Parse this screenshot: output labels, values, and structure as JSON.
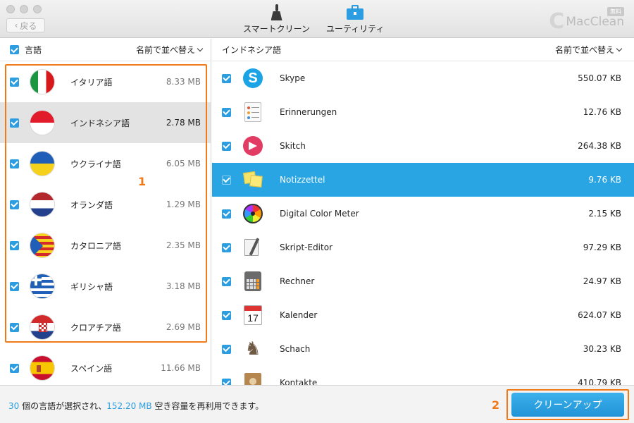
{
  "window": {
    "back_label": "戻る",
    "toolbar": [
      {
        "label": "スマートクリーン",
        "icon": "broom-icon"
      },
      {
        "label": "ユーティリティ",
        "icon": "toolbox-icon",
        "active": true
      }
    ],
    "brand": "MacClean",
    "badge": "無料"
  },
  "left_panel": {
    "header_label": "言語",
    "sort_label": "名前で並べ替え",
    "languages": [
      {
        "name": "イタリア語",
        "size": "8.33 MB",
        "flag": "italy-flag-icon"
      },
      {
        "name": "インドネシア語",
        "size": "2.78 MB",
        "flag": "indonesia-flag-icon",
        "selected": true
      },
      {
        "name": "ウクライナ語",
        "size": "6.05 MB",
        "flag": "ukraine-flag-icon"
      },
      {
        "name": "オランダ語",
        "size": "1.29 MB",
        "flag": "netherlands-flag-icon"
      },
      {
        "name": "カタロニア語",
        "size": "2.35 MB",
        "flag": "catalonia-flag-icon"
      },
      {
        "name": "ギリシャ語",
        "size": "3.18 MB",
        "flag": "greece-flag-icon"
      },
      {
        "name": "クロアチア語",
        "size": "2.69 MB",
        "flag": "croatia-flag-icon"
      },
      {
        "name": "スペイン語",
        "size": "11.66 MB",
        "flag": "spain-flag-icon"
      }
    ],
    "annotation": "1"
  },
  "right_panel": {
    "header_label": "インドネシア語",
    "sort_label": "名前で並べ替え",
    "apps": [
      {
        "name": "Skype",
        "size": "550.07 KB",
        "icon": "skype-icon"
      },
      {
        "name": "Erinnerungen",
        "size": "12.76 KB",
        "icon": "reminders-icon"
      },
      {
        "name": "Skitch",
        "size": "264.38 KB",
        "icon": "skitch-icon"
      },
      {
        "name": "Notizzettel",
        "size": "9.76 KB",
        "icon": "stickies-icon",
        "selected": true
      },
      {
        "name": "Digital Color Meter",
        "size": "2.15 KB",
        "icon": "color-meter-icon"
      },
      {
        "name": "Skript-Editor",
        "size": "97.29 KB",
        "icon": "script-editor-icon"
      },
      {
        "name": "Rechner",
        "size": "24.97 KB",
        "icon": "calculator-icon"
      },
      {
        "name": "Kalender",
        "size": "624.07 KB",
        "icon": "calendar-icon",
        "icon_text": "17"
      },
      {
        "name": "Schach",
        "size": "30.23 KB",
        "icon": "chess-icon"
      },
      {
        "name": "Kontakte",
        "size": "410.79 KB",
        "icon": "contacts-icon"
      }
    ]
  },
  "footer": {
    "count": "30",
    "text1": " 個の言語が選択され、",
    "space": "152.20 MB",
    "text2": " 空き容量を再利用できます。",
    "button_label": "クリーンアップ",
    "annotation": "2"
  },
  "colors": {
    "accent": "#2b9de0",
    "selected_row": "#2aa5e3",
    "highlight": "#f07a1a"
  }
}
